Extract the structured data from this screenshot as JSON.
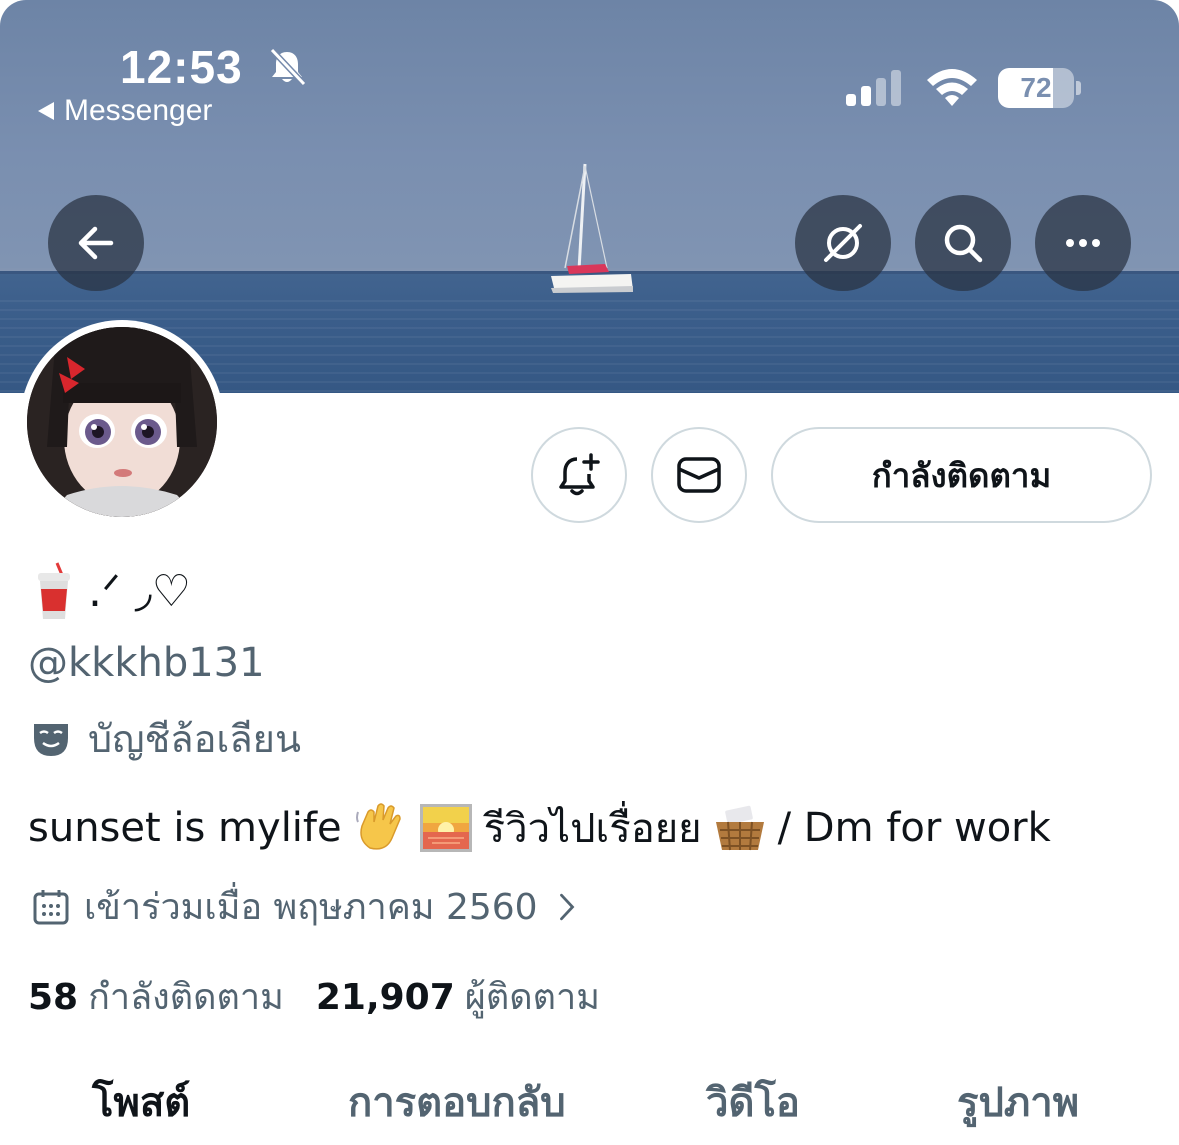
{
  "status_bar": {
    "time": "12:53",
    "back_app": "Messenger",
    "battery": "72",
    "battery_level": 0.72,
    "signal_bars_active": 2
  },
  "header": {
    "icons": [
      "back-arrow-icon",
      "grok-icon",
      "search-icon",
      "more-icon"
    ]
  },
  "profile": {
    "display_name_text": ".ᐟ‎ ◞♡",
    "display_name_emoji": "cup-with-straw",
    "handle": "@kkkhb131",
    "parody_label": "บัญชีล้อเลียน",
    "bio_part1": "sunset is mylife",
    "bio_part2": "รีวิวไปเรื่อยย",
    "bio_part3": "/ Dm for work",
    "joined": "เข้าร่วมเมื่อ พฤษภาคม 2560",
    "following_count": "58",
    "following_label": "กำลังติดตาม",
    "followers_count": "21,907",
    "followers_label": "ผู้ติดตาม"
  },
  "actions": {
    "follow_label": "กำลังติดตาม"
  },
  "tabs": [
    {
      "label": "โพสต์",
      "active": true
    },
    {
      "label": "การตอบกลับ",
      "active": false
    },
    {
      "label": "วิดีโอ",
      "active": false
    },
    {
      "label": "รูปภาพ",
      "active": false
    }
  ],
  "colors": {
    "text_primary": "#0f1419",
    "text_secondary": "#536471",
    "border": "#cfd9de"
  }
}
